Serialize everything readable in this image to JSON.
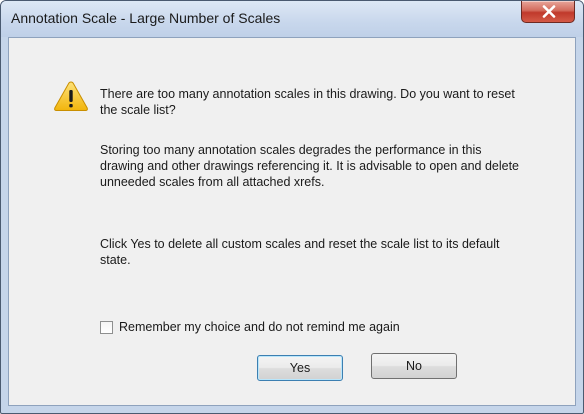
{
  "window": {
    "title": "Annotation Scale - Large Number of Scales"
  },
  "dialog": {
    "icon": "warning-icon",
    "main_message": "There are too many annotation scales in this drawing. Do you want to reset the scale list?",
    "detail_message": "Storing too many annotation scales degrades the performance in this drawing and other drawings referencing it. It is advisable to open and delete unneeded scales from all attached xrefs.",
    "click_message": "Click Yes to delete all custom scales and reset the scale list to its default state.",
    "checkbox": {
      "label": "Remember my choice and do not remind me again",
      "checked": false
    },
    "buttons": {
      "yes": "Yes",
      "no": "No"
    }
  },
  "colors": {
    "warning_yellow": "#f5c518",
    "close_red": "#c0392b",
    "default_button_border": "#3c7fb1"
  }
}
